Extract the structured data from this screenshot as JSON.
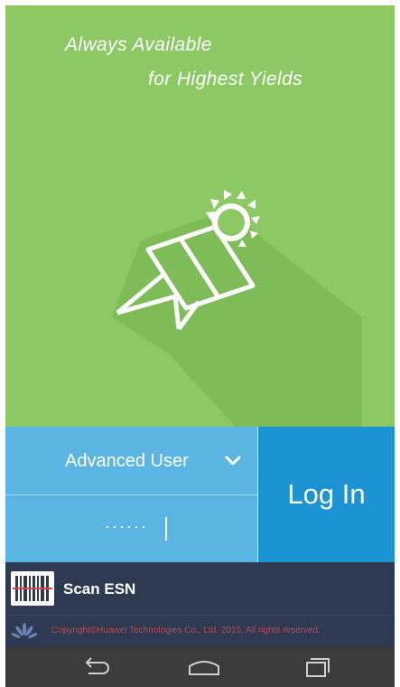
{
  "hero": {
    "slogan_line1": "Always Available",
    "slogan_line2": "for Highest Yields",
    "background_color": "#8cc864",
    "illustration_icon": "solar-panel-sun-icon"
  },
  "login": {
    "user_type": "Advanced User",
    "password_masked": "······",
    "login_label": "Log In",
    "field_color": "#5bb5e2",
    "button_color": "#1c94d3"
  },
  "scan": {
    "label": "Scan ESN",
    "icon": "barcode-scan-icon"
  },
  "footer": {
    "copyright": "Copyright©Huawei Technologies Co., Ltd. 2015. All rights reserved.",
    "logo_icon": "huawei-logo-icon",
    "text_color": "#b34d55"
  },
  "navbar": {
    "buttons": [
      "back-icon",
      "home-icon",
      "recent-apps-icon"
    ]
  }
}
